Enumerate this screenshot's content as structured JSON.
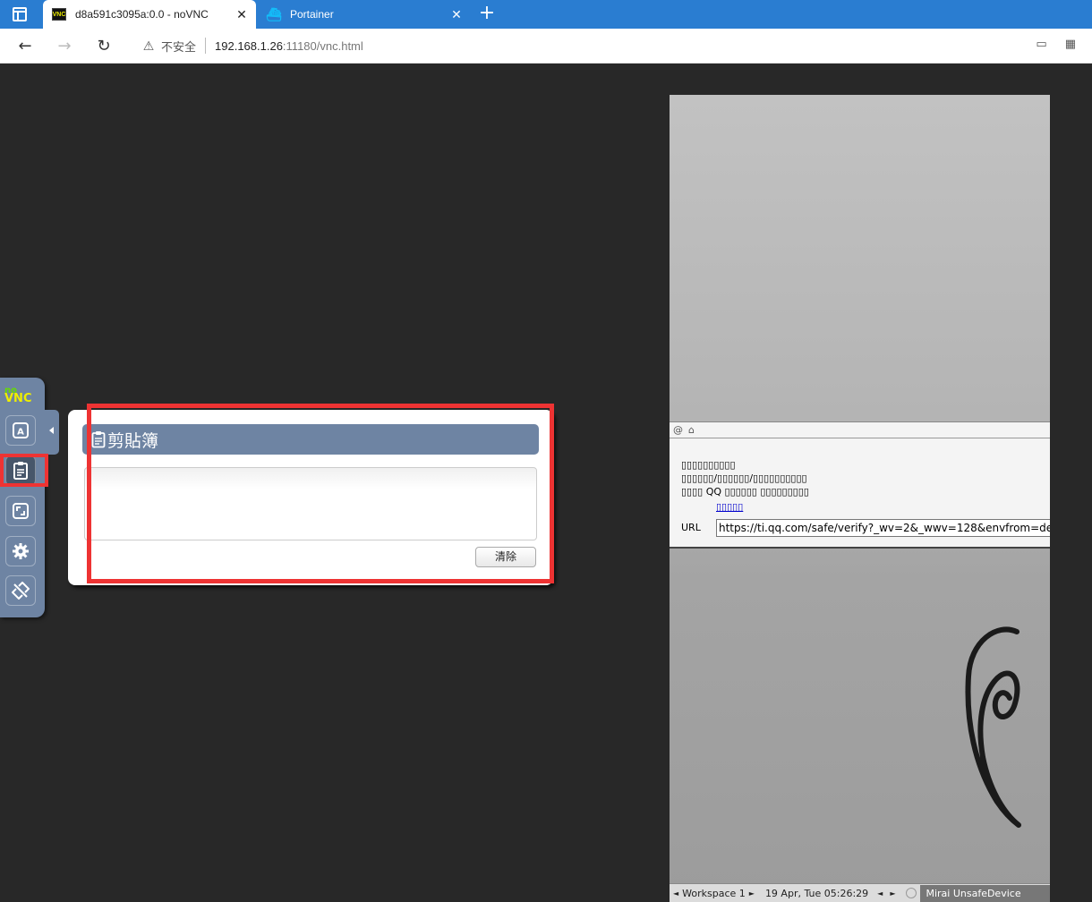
{
  "browser": {
    "tabs": [
      {
        "title": "d8a591c3095a:0.0 - noVNC",
        "favicon": "vnc-favicon",
        "favicon_text": "VNC",
        "active": true
      },
      {
        "title": "Portainer",
        "favicon": "portainer-favicon",
        "active": false
      }
    ],
    "new_tab_label": "+",
    "security_label": "不安全",
    "url_host": "192.168.1.26",
    "url_rest": ":11180/vnc.html"
  },
  "novnc": {
    "logo_no": "no",
    "logo_vnc": "VNC",
    "control_buttons": [
      {
        "name": "extra-keys-button",
        "icon": "keyboard-a-icon"
      },
      {
        "name": "clipboard-button",
        "icon": "clipboard-icon",
        "selected": true
      },
      {
        "name": "fullscreen-button",
        "icon": "fullscreen-icon"
      },
      {
        "name": "settings-button",
        "icon": "gear-icon"
      },
      {
        "name": "disconnect-button",
        "icon": "disconnect-icon"
      }
    ],
    "clipboard": {
      "title": "剪貼簿",
      "text_value": "",
      "clear_label": "清除"
    }
  },
  "remote": {
    "dialog": {
      "line1": "▯▯▯▯▯▯▯▯▯▯",
      "line2": "▯▯▯▯▯▯/▯▯▯▯▯▯/▯▯▯▯▯▯▯▯▯▯",
      "line3": "▯▯▯▯ QQ ▯▯▯▯▯▯ ▯▯▯▯▯▯▯▯▯",
      "link": "▯▯▯▯▯",
      "url_label": "URL",
      "url_value": "https://ti.qq.com/safe/verify?_wv=2&_wwv=128&envfrom=de"
    },
    "taskbar": {
      "workspace": "Workspace 1",
      "datetime": "19 Apr, Tue 05:26:29",
      "window_title": "Mirai UnsafeDevice"
    }
  },
  "colors": {
    "tabbar": "#2a7dd1",
    "novnc_panel": "#6e84a3",
    "highlight": "#ee3333",
    "background": "#282828"
  }
}
